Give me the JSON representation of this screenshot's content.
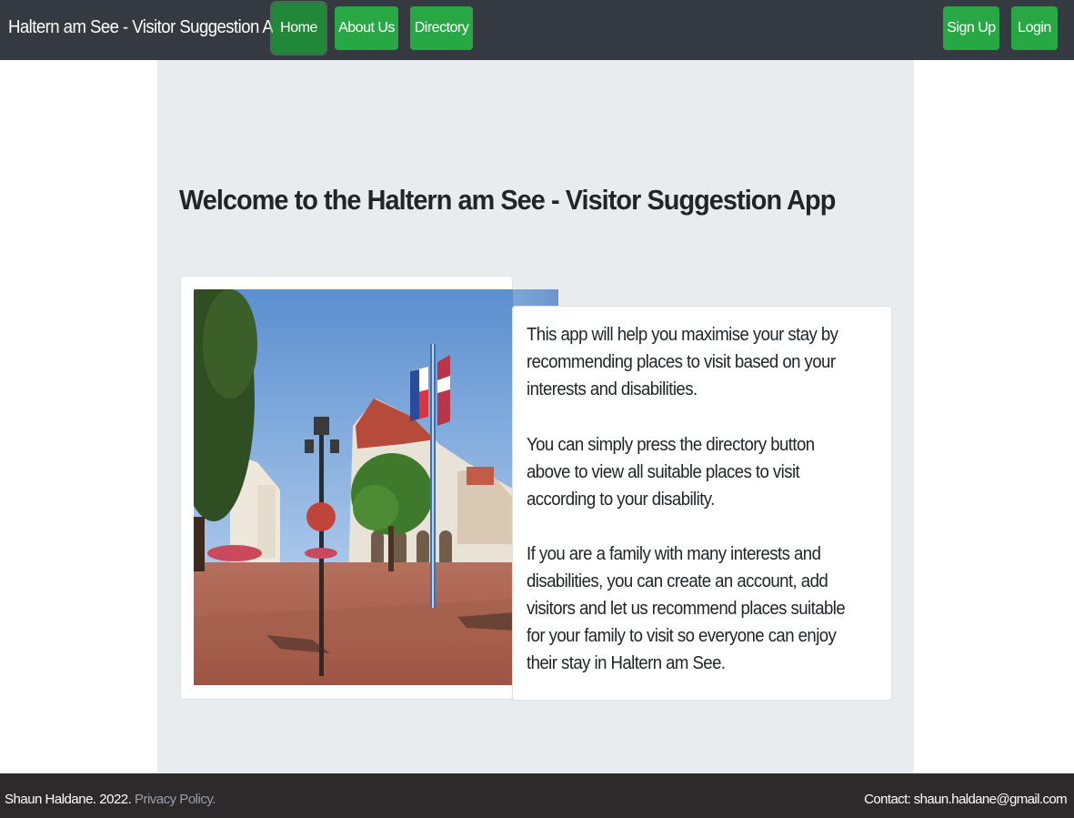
{
  "navbar": {
    "brand": "Haltern am See - Visitor Suggestion App",
    "links": {
      "home": "Home",
      "about": "About Us",
      "directory": "Directory"
    },
    "auth": {
      "signup": "Sign Up",
      "login": "Login"
    }
  },
  "main": {
    "title": "Welcome to the Haltern am See - Visitor Suggestion App",
    "paragraphs": [
      "This app will help you maximise your stay by recommending places to visit based on your interests and disabilities.",
      "You can simply press the directory button above to view all suitable places to visit according to your disability.",
      "If you are a family with many interests and disabilities, you can create an account, add visitors and let us recommend places suitable for your family to visit so everyone can enjoy their stay in Haltern am See."
    ]
  },
  "footer": {
    "author": "Shaun Haldane. 2022.",
    "privacy": "Privacy Policy.",
    "contact": "Contact: shaun.haldane@gmail.com"
  },
  "colors": {
    "navbar": "#343a40",
    "button": "#28a745",
    "jumbotron": "#e9ecef",
    "footer": "#2d2a2b"
  }
}
